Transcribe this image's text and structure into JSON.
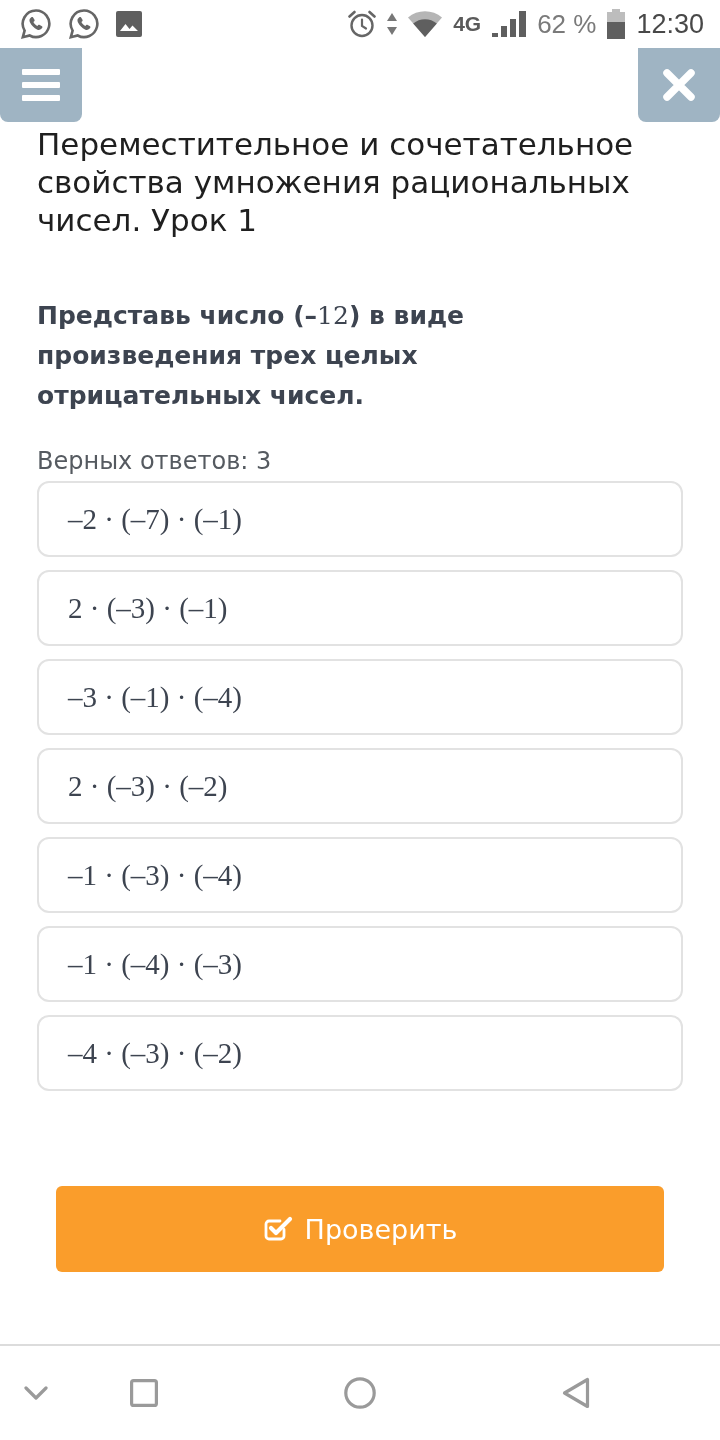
{
  "status_bar": {
    "network": "4G",
    "battery": "62 %",
    "time": "12:30"
  },
  "lesson_title": "Переместительное и сочетательное свойства умножения рациональных чисел. Урок 1",
  "question": [
    {
      "kind": "text",
      "text": "Представь число (–"
    },
    {
      "kind": "math",
      "text": "12"
    },
    {
      "kind": "text",
      "text": ") в виде произведения трех целых отрицательных чисел."
    }
  ],
  "answer_count": "Верных ответов: 3",
  "options": [
    {
      "text": "–2 · (–7) · (–1)",
      "selected": false
    },
    {
      "text": "2 · (–3) · (–1)",
      "selected": false
    },
    {
      "text": "–3 · (–1) · (–4)",
      "selected": false
    },
    {
      "text": "2 · (–3) · (–2)",
      "selected": false
    },
    {
      "text": "–1 · (–3) · (–4)",
      "selected": false
    },
    {
      "text": "–1 · (–4) · (–3)",
      "selected": false
    },
    {
      "text": "–4 · (–3) · (–2)",
      "selected": false
    }
  ],
  "check_button": {
    "label": "Проверить"
  }
}
